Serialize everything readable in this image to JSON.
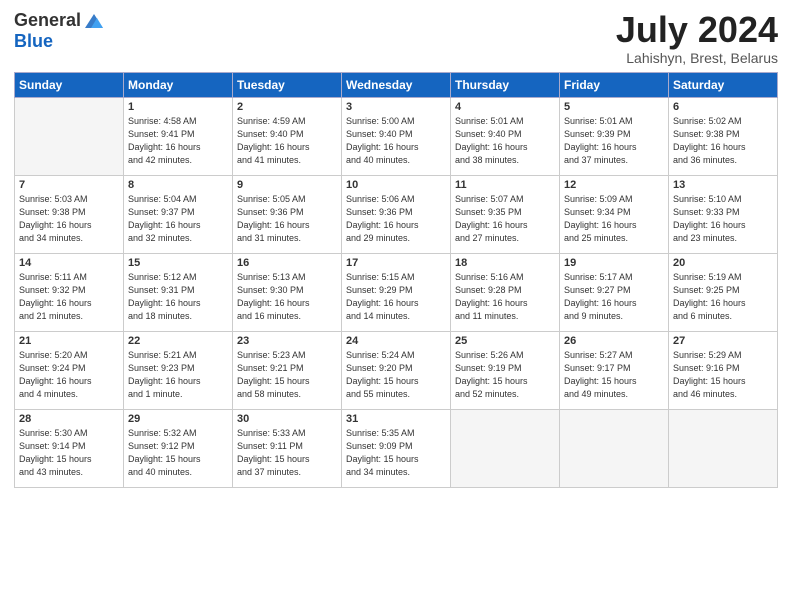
{
  "logo": {
    "general": "General",
    "blue": "Blue"
  },
  "title": "July 2024",
  "location": "Lahishyn, Brest, Belarus",
  "days_of_week": [
    "Sunday",
    "Monday",
    "Tuesday",
    "Wednesday",
    "Thursday",
    "Friday",
    "Saturday"
  ],
  "weeks": [
    [
      {
        "day": "",
        "info": ""
      },
      {
        "day": "1",
        "info": "Sunrise: 4:58 AM\nSunset: 9:41 PM\nDaylight: 16 hours\nand 42 minutes."
      },
      {
        "day": "2",
        "info": "Sunrise: 4:59 AM\nSunset: 9:40 PM\nDaylight: 16 hours\nand 41 minutes."
      },
      {
        "day": "3",
        "info": "Sunrise: 5:00 AM\nSunset: 9:40 PM\nDaylight: 16 hours\nand 40 minutes."
      },
      {
        "day": "4",
        "info": "Sunrise: 5:01 AM\nSunset: 9:40 PM\nDaylight: 16 hours\nand 38 minutes."
      },
      {
        "day": "5",
        "info": "Sunrise: 5:01 AM\nSunset: 9:39 PM\nDaylight: 16 hours\nand 37 minutes."
      },
      {
        "day": "6",
        "info": "Sunrise: 5:02 AM\nSunset: 9:38 PM\nDaylight: 16 hours\nand 36 minutes."
      }
    ],
    [
      {
        "day": "7",
        "info": "Sunrise: 5:03 AM\nSunset: 9:38 PM\nDaylight: 16 hours\nand 34 minutes."
      },
      {
        "day": "8",
        "info": "Sunrise: 5:04 AM\nSunset: 9:37 PM\nDaylight: 16 hours\nand 32 minutes."
      },
      {
        "day": "9",
        "info": "Sunrise: 5:05 AM\nSunset: 9:36 PM\nDaylight: 16 hours\nand 31 minutes."
      },
      {
        "day": "10",
        "info": "Sunrise: 5:06 AM\nSunset: 9:36 PM\nDaylight: 16 hours\nand 29 minutes."
      },
      {
        "day": "11",
        "info": "Sunrise: 5:07 AM\nSunset: 9:35 PM\nDaylight: 16 hours\nand 27 minutes."
      },
      {
        "day": "12",
        "info": "Sunrise: 5:09 AM\nSunset: 9:34 PM\nDaylight: 16 hours\nand 25 minutes."
      },
      {
        "day": "13",
        "info": "Sunrise: 5:10 AM\nSunset: 9:33 PM\nDaylight: 16 hours\nand 23 minutes."
      }
    ],
    [
      {
        "day": "14",
        "info": "Sunrise: 5:11 AM\nSunset: 9:32 PM\nDaylight: 16 hours\nand 21 minutes."
      },
      {
        "day": "15",
        "info": "Sunrise: 5:12 AM\nSunset: 9:31 PM\nDaylight: 16 hours\nand 18 minutes."
      },
      {
        "day": "16",
        "info": "Sunrise: 5:13 AM\nSunset: 9:30 PM\nDaylight: 16 hours\nand 16 minutes."
      },
      {
        "day": "17",
        "info": "Sunrise: 5:15 AM\nSunset: 9:29 PM\nDaylight: 16 hours\nand 14 minutes."
      },
      {
        "day": "18",
        "info": "Sunrise: 5:16 AM\nSunset: 9:28 PM\nDaylight: 16 hours\nand 11 minutes."
      },
      {
        "day": "19",
        "info": "Sunrise: 5:17 AM\nSunset: 9:27 PM\nDaylight: 16 hours\nand 9 minutes."
      },
      {
        "day": "20",
        "info": "Sunrise: 5:19 AM\nSunset: 9:25 PM\nDaylight: 16 hours\nand 6 minutes."
      }
    ],
    [
      {
        "day": "21",
        "info": "Sunrise: 5:20 AM\nSunset: 9:24 PM\nDaylight: 16 hours\nand 4 minutes."
      },
      {
        "day": "22",
        "info": "Sunrise: 5:21 AM\nSunset: 9:23 PM\nDaylight: 16 hours\nand 1 minute."
      },
      {
        "day": "23",
        "info": "Sunrise: 5:23 AM\nSunset: 9:21 PM\nDaylight: 15 hours\nand 58 minutes."
      },
      {
        "day": "24",
        "info": "Sunrise: 5:24 AM\nSunset: 9:20 PM\nDaylight: 15 hours\nand 55 minutes."
      },
      {
        "day": "25",
        "info": "Sunrise: 5:26 AM\nSunset: 9:19 PM\nDaylight: 15 hours\nand 52 minutes."
      },
      {
        "day": "26",
        "info": "Sunrise: 5:27 AM\nSunset: 9:17 PM\nDaylight: 15 hours\nand 49 minutes."
      },
      {
        "day": "27",
        "info": "Sunrise: 5:29 AM\nSunset: 9:16 PM\nDaylight: 15 hours\nand 46 minutes."
      }
    ],
    [
      {
        "day": "28",
        "info": "Sunrise: 5:30 AM\nSunset: 9:14 PM\nDaylight: 15 hours\nand 43 minutes."
      },
      {
        "day": "29",
        "info": "Sunrise: 5:32 AM\nSunset: 9:12 PM\nDaylight: 15 hours\nand 40 minutes."
      },
      {
        "day": "30",
        "info": "Sunrise: 5:33 AM\nSunset: 9:11 PM\nDaylight: 15 hours\nand 37 minutes."
      },
      {
        "day": "31",
        "info": "Sunrise: 5:35 AM\nSunset: 9:09 PM\nDaylight: 15 hours\nand 34 minutes."
      },
      {
        "day": "",
        "info": ""
      },
      {
        "day": "",
        "info": ""
      },
      {
        "day": "",
        "info": ""
      }
    ]
  ]
}
